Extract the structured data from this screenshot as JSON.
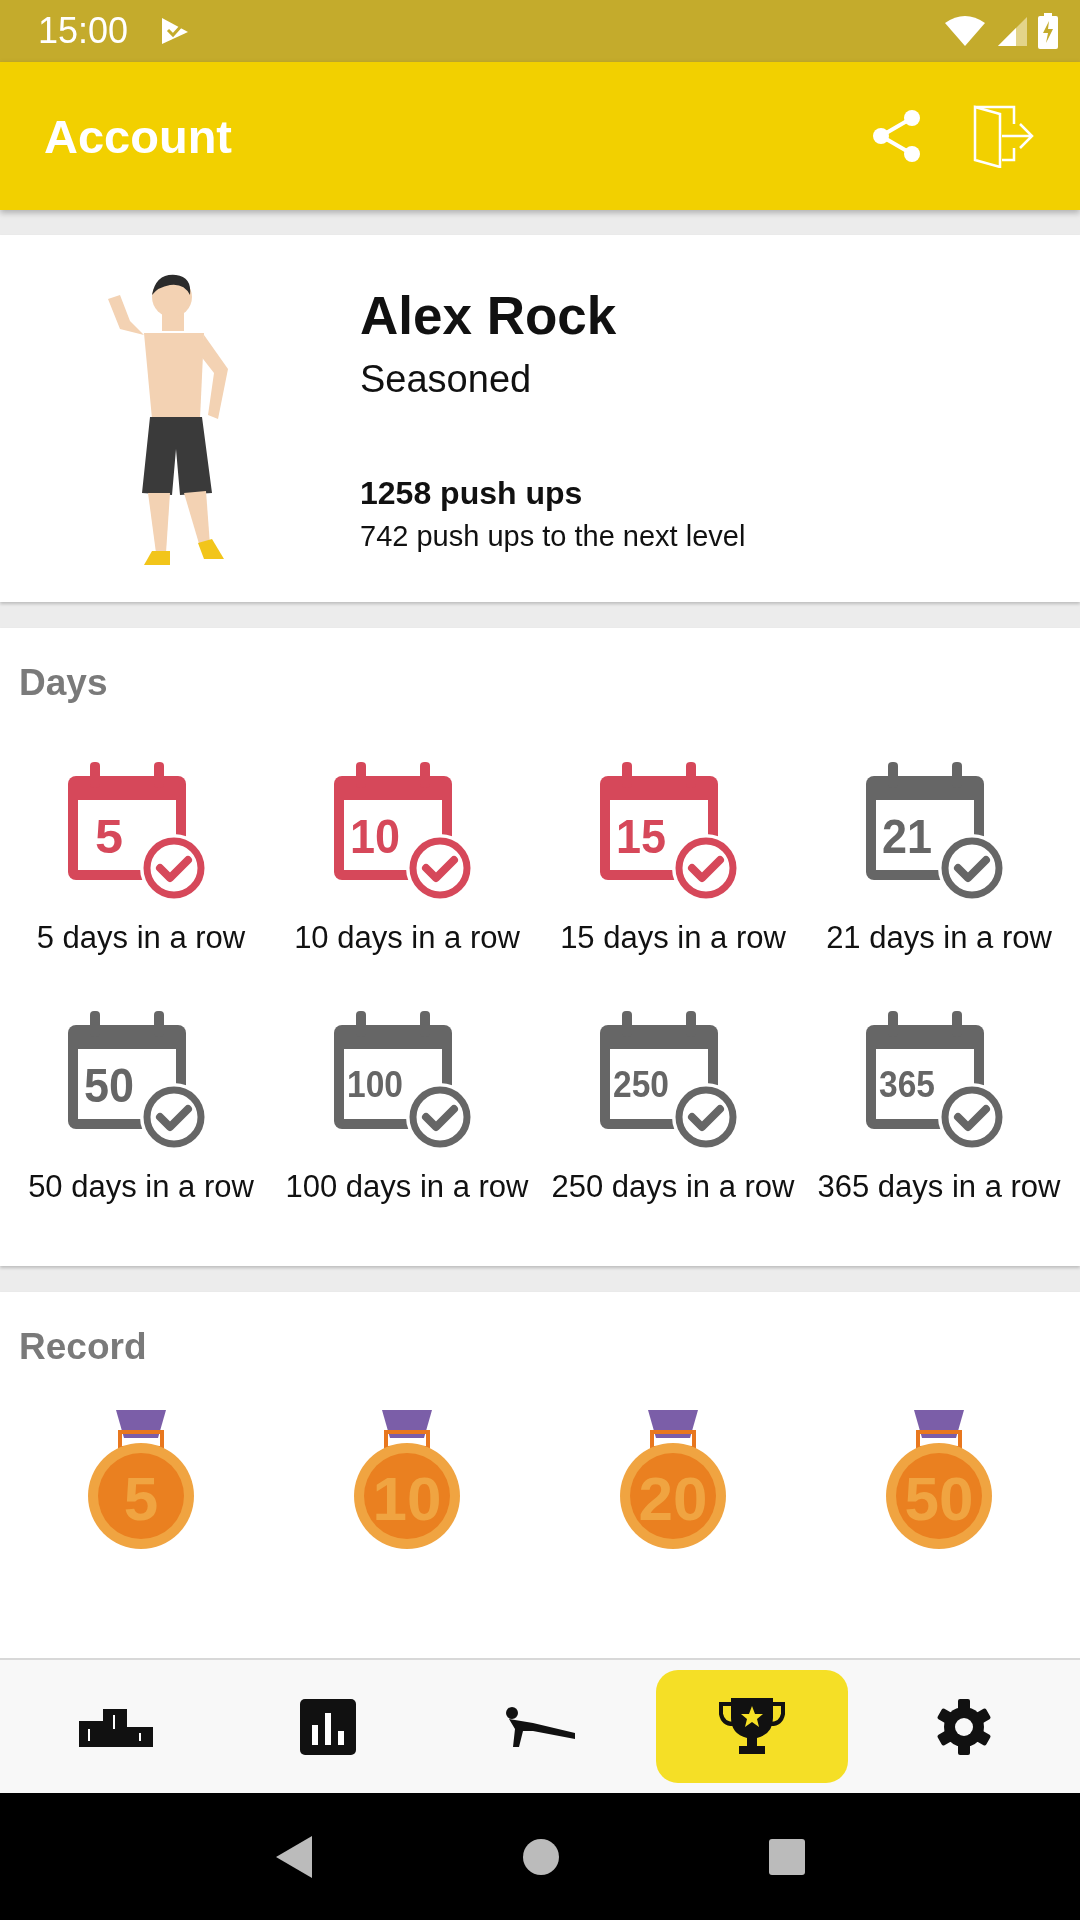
{
  "status_bar": {
    "time": "15:00"
  },
  "app_bar": {
    "title": "Account"
  },
  "profile": {
    "name": "Alex Rock",
    "level_name": "Seasoned",
    "total": "1258 push ups",
    "to_next": "742 push ups to the next level"
  },
  "days": {
    "title": "Days",
    "badges": [
      {
        "number": "5",
        "label": "5 days in a row",
        "achieved": true
      },
      {
        "number": "10",
        "label": "10 days in a row",
        "achieved": true
      },
      {
        "number": "15",
        "label": "15 days in a row",
        "achieved": true
      },
      {
        "number": "21",
        "label": "21 days in a row",
        "achieved": false
      },
      {
        "number": "50",
        "label": "50 days in a row",
        "achieved": false
      },
      {
        "number": "100",
        "label": "100 days in a row",
        "achieved": false
      },
      {
        "number": "250",
        "label": "250 days in a row",
        "achieved": false
      },
      {
        "number": "365",
        "label": "365 days in a row",
        "achieved": false
      }
    ]
  },
  "record": {
    "title": "Record",
    "medals": [
      {
        "number": "5"
      },
      {
        "number": "10"
      },
      {
        "number": "20"
      },
      {
        "number": "50"
      }
    ]
  },
  "bottom_nav": [
    {
      "kind": "podium",
      "selected": false
    },
    {
      "kind": "chart",
      "selected": false
    },
    {
      "kind": "pushup",
      "selected": false
    },
    {
      "kind": "trophy",
      "selected": true
    },
    {
      "kind": "settings",
      "selected": false
    }
  ]
}
